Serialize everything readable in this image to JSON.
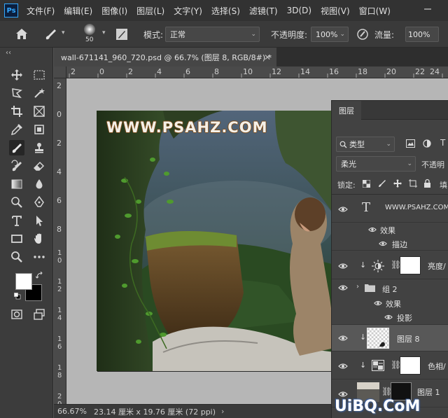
{
  "menubar": {
    "logo": "Ps",
    "items": [
      "文件(F)",
      "编辑(E)",
      "图像(I)",
      "图层(L)",
      "文字(Y)",
      "选择(S)",
      "滤镜(T)",
      "3D(D)",
      "视图(V)",
      "窗口(W)"
    ]
  },
  "options": {
    "brush_size": "50",
    "mode_label": "模式:",
    "mode_value": "正常",
    "opacity_label": "不透明度:",
    "opacity_value": "100%",
    "flow_label": "流量:",
    "flow_value": "100%"
  },
  "toolbar": {
    "collapse_label": "‹‹",
    "foreground_color": "#ffffff",
    "background_color": "#000000"
  },
  "document": {
    "tab_title": "wall-671141_960_720.psd @ 66.7% (图层 8, RGB/8#) *",
    "canvas_text": "WWW.PSAHZ.COM"
  },
  "rulers": {
    "top": [
      "2",
      "0",
      "2",
      "4",
      "6",
      "8",
      "10",
      "12",
      "14",
      "16",
      "18",
      "20",
      "22",
      "24"
    ],
    "left": [
      "2",
      "0",
      "2",
      "4",
      "6",
      "8",
      "1\n0",
      "1\n2",
      "1\n4",
      "1\n6",
      "1\n8",
      "2\n0",
      "2\n2"
    ]
  },
  "status": {
    "zoom": "66.67%",
    "doc_size": "23.14 厘米 x 19.76 厘米 (72 ppi)"
  },
  "layers_panel": {
    "tab_label": "图层",
    "filter_label": "类型",
    "blend_mode": "柔光",
    "opacity_label": "不透明",
    "lock_label": "锁定:",
    "fill_label": "填",
    "layers": [
      {
        "name": "WWW.PSAHZ.COM",
        "kind": "text"
      },
      {
        "name": "效果",
        "kind": "effects"
      },
      {
        "name": "描边",
        "kind": "effect-item"
      },
      {
        "name": "亮度/",
        "kind": "adjustment"
      },
      {
        "name": "组 2",
        "kind": "group"
      },
      {
        "name": "效果",
        "kind": "effects"
      },
      {
        "name": "投影",
        "kind": "effect-item"
      },
      {
        "name": "图层 8",
        "kind": "pixel",
        "selected": true
      },
      {
        "name": "色相/",
        "kind": "adjustment"
      },
      {
        "name": "图层 1",
        "kind": "pixel"
      }
    ]
  },
  "brand": {
    "text": "UiBQ.CoM"
  }
}
